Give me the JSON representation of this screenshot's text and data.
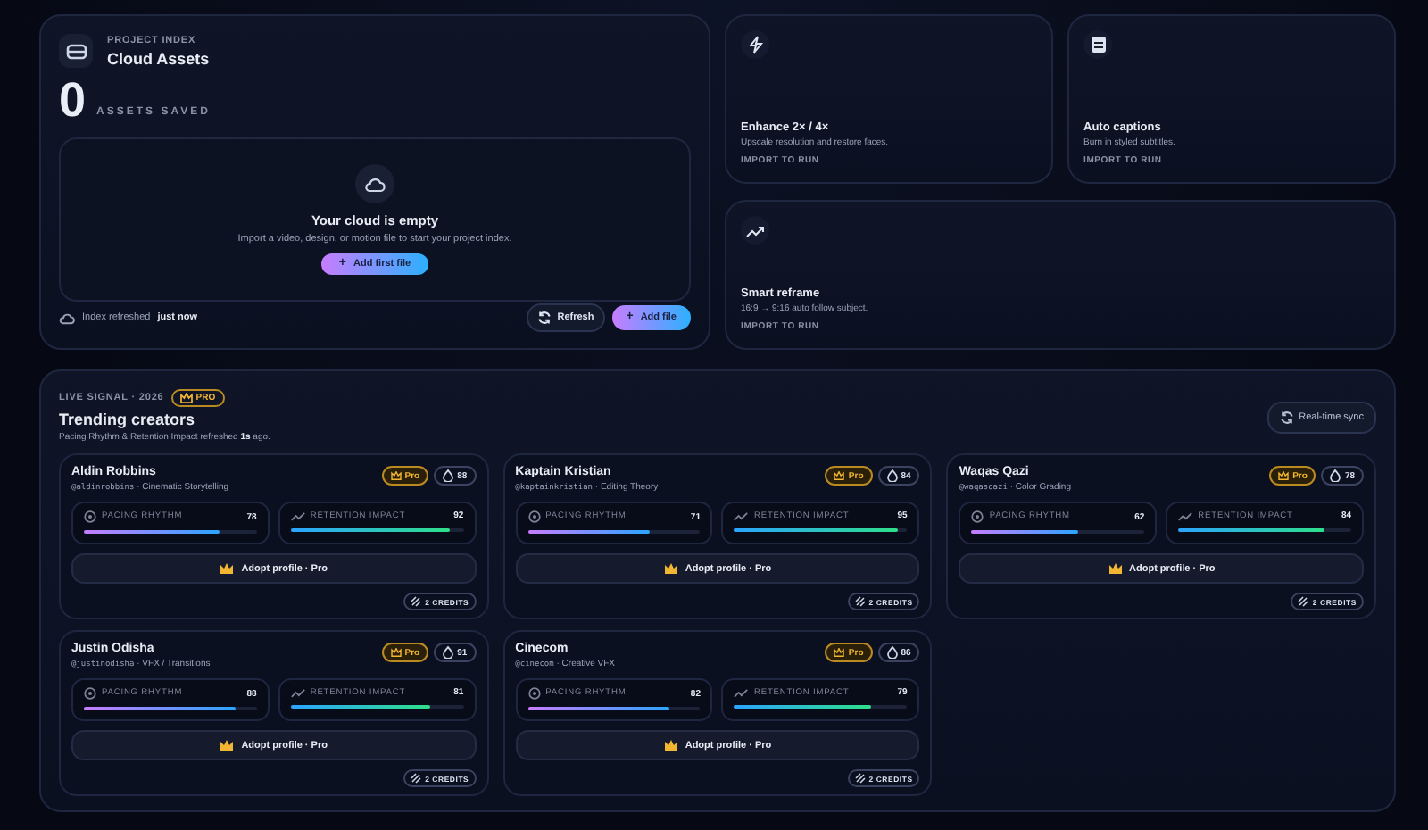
{
  "cloud": {
    "eyebrow": "PROJECT INDEX",
    "title": "Cloud Assets",
    "count": "0",
    "count_label": "ASSETS SAVED",
    "empty_title": "Your cloud is empty",
    "empty_text": "Import a video, design, or motion file to start your project index.",
    "plus": "+",
    "empty_button": "Add first file",
    "refreshed_label": "Index refreshed",
    "refreshed_time": "just now",
    "refresh_button": "Refresh",
    "add_plus": "+",
    "add_button": "Add file"
  },
  "tools": [
    {
      "kind": "enhance",
      "title": "Enhance 2× / 4×",
      "text": "Upscale resolution and restore faces.",
      "action": "IMPORT TO RUN"
    },
    {
      "kind": "captions",
      "title": "Auto captions",
      "text": "Burn in styled subtitles.",
      "action": "IMPORT TO RUN"
    },
    {
      "kind": "reframe",
      "title": "Smart reframe",
      "text": "16:9 → 9:16 auto follow subject.",
      "action": "IMPORT TO RUN"
    }
  ],
  "trending": {
    "eyebrow": "LIVE SIGNAL · 2026",
    "badge": "PRO",
    "title": "Trending creators",
    "subtitle": "Pacing Rhythm & Retention Impact refreshed **1s** ago.",
    "sync_button": "Real-time sync",
    "creators": [
      {
        "name": "Aldin Robbins",
        "handle": "@aldinrobbins",
        "niche": "· Cinematic Storytelling",
        "tier": "Pro",
        "score": "88",
        "metrics": [
          {
            "kind": "pacing",
            "label": "PACING RHYTHM",
            "value": "78",
            "level": 0.78
          },
          {
            "kind": "retention",
            "label": "RETENTION IMPACT",
            "value": "92",
            "level": 0.92
          }
        ],
        "button": "Adopt profile · Pro",
        "credits": "2 CREDITS"
      },
      {
        "name": "Kaptain Kristian",
        "handle": "@kaptainkristian",
        "niche": "· Editing Theory",
        "tier": "Pro",
        "score": "84",
        "metrics": [
          {
            "kind": "pacing",
            "label": "PACING RHYTHM",
            "value": "71",
            "level": 0.71
          },
          {
            "kind": "retention",
            "label": "RETENTION IMPACT",
            "value": "95",
            "level": 0.95
          }
        ],
        "button": "Adopt profile · Pro",
        "credits": "2 CREDITS"
      },
      {
        "name": "Waqas Qazi",
        "handle": "@waqasqazi",
        "niche": "· Color Grading",
        "tier": "Pro",
        "score": "78",
        "metrics": [
          {
            "kind": "pacing",
            "label": "PACING RHYTHM",
            "value": "62",
            "level": 0.62
          },
          {
            "kind": "retention",
            "label": "RETENTION IMPACT",
            "value": "84",
            "level": 0.84
          }
        ],
        "button": "Adopt profile · Pro",
        "credits": "2 CREDITS"
      },
      {
        "name": "Justin Odisha",
        "handle": "@justinodisha",
        "niche": "· VFX / Transitions",
        "tier": "Pro",
        "score": "91",
        "metrics": [
          {
            "kind": "pacing",
            "label": "PACING RHYTHM",
            "value": "88",
            "level": 0.88
          },
          {
            "kind": "retention",
            "label": "RETENTION IMPACT",
            "value": "81",
            "level": 0.81
          }
        ],
        "button": "Adopt profile · Pro",
        "credits": "2 CREDITS"
      },
      {
        "name": "Cinecom",
        "handle": "@cinecom",
        "niche": "· Creative VFX",
        "tier": "Pro",
        "score": "86",
        "metrics": [
          {
            "kind": "pacing",
            "label": "PACING RHYTHM",
            "value": "82",
            "level": 0.82
          },
          {
            "kind": "retention",
            "label": "RETENTION IMPACT",
            "value": "79",
            "level": 0.79
          }
        ],
        "button": "Adopt profile · Pro",
        "credits": "2 CREDITS"
      }
    ]
  }
}
